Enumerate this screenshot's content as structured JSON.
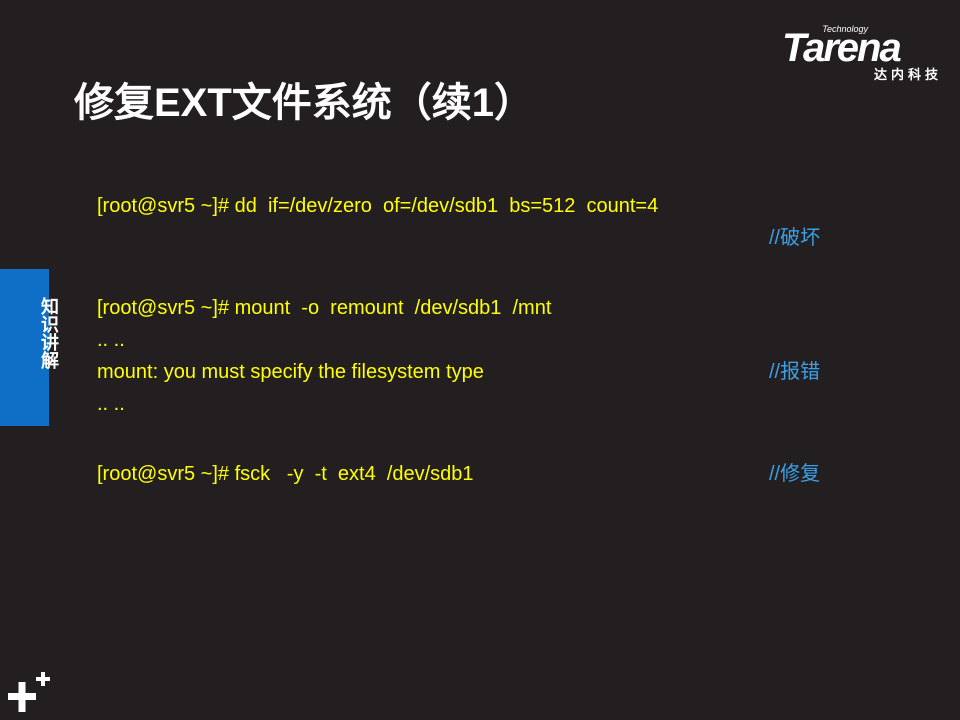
{
  "title": "修复EXT文件系统（续1）",
  "logo": {
    "tagline": "Technology",
    "word": "Tarena",
    "chinese": "达内科技"
  },
  "side_tab": {
    "label": "知识讲解"
  },
  "code_lines": [
    {
      "cmd": "[root@svr5 ~]# dd  if=/dev/zero  of=/dev/sdb1  bs=512  count=4",
      "comment": ""
    },
    {
      "cmd": "",
      "comment": "//破坏"
    },
    {
      "cmd": "[root@svr5 ~]# mount  -o  remount  /dev/sdb1  /mnt",
      "comment": ""
    },
    {
      "cmd": ".. ..",
      "comment": ""
    },
    {
      "cmd": "mount: you must specify the filesystem type",
      "comment": "//报错"
    },
    {
      "cmd": ".. ..",
      "comment": ""
    },
    {
      "cmd": "[root@svr5 ~]# fsck   -y  -t  ext4  /dev/sdb1",
      "comment": "//修复"
    }
  ],
  "colors": {
    "background": "#231f20",
    "command": "#ffff00",
    "comment": "#3aa0e8",
    "tab": "#0f6fc6",
    "title": "#ffffff"
  },
  "icons": {
    "corner": "plus-plus-icon"
  }
}
